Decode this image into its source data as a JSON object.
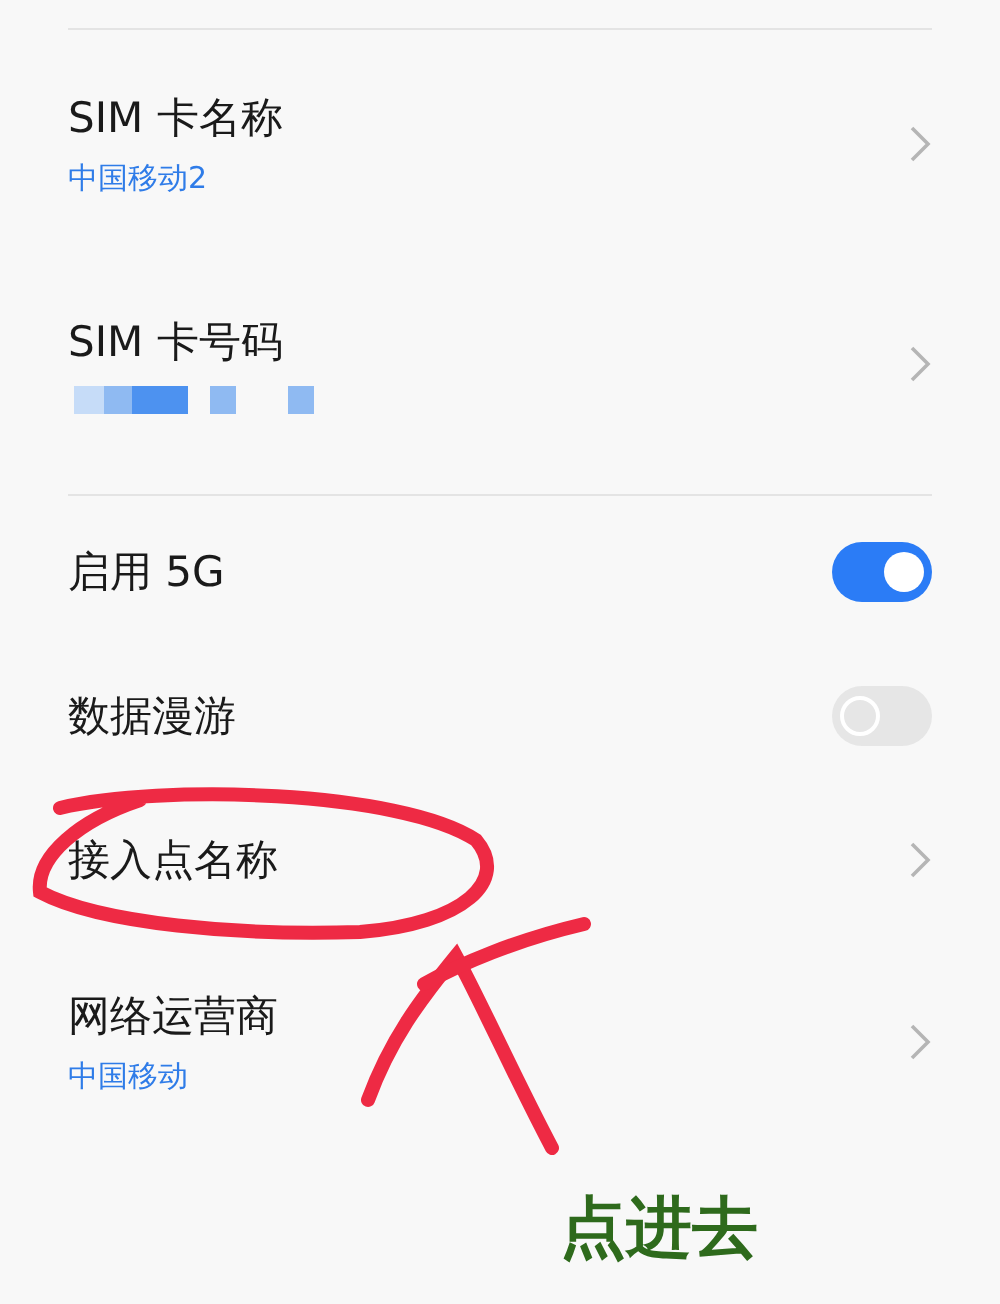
{
  "sections": [
    {
      "items": [
        {
          "kind": "nav",
          "title": "SIM 卡名称",
          "subtitle": "中国移动2"
        },
        {
          "kind": "nav",
          "title": "SIM 卡号码",
          "redacted": true
        }
      ]
    },
    {
      "items": [
        {
          "kind": "toggle",
          "title": "启用 5G",
          "on": true
        },
        {
          "kind": "toggle",
          "title": "数据漫游",
          "on": false
        },
        {
          "kind": "nav",
          "title": "接入点名称"
        },
        {
          "kind": "nav",
          "title": "网络运营商",
          "subtitle": "中国移动"
        }
      ]
    }
  ],
  "annotation": {
    "text": "点进去"
  }
}
